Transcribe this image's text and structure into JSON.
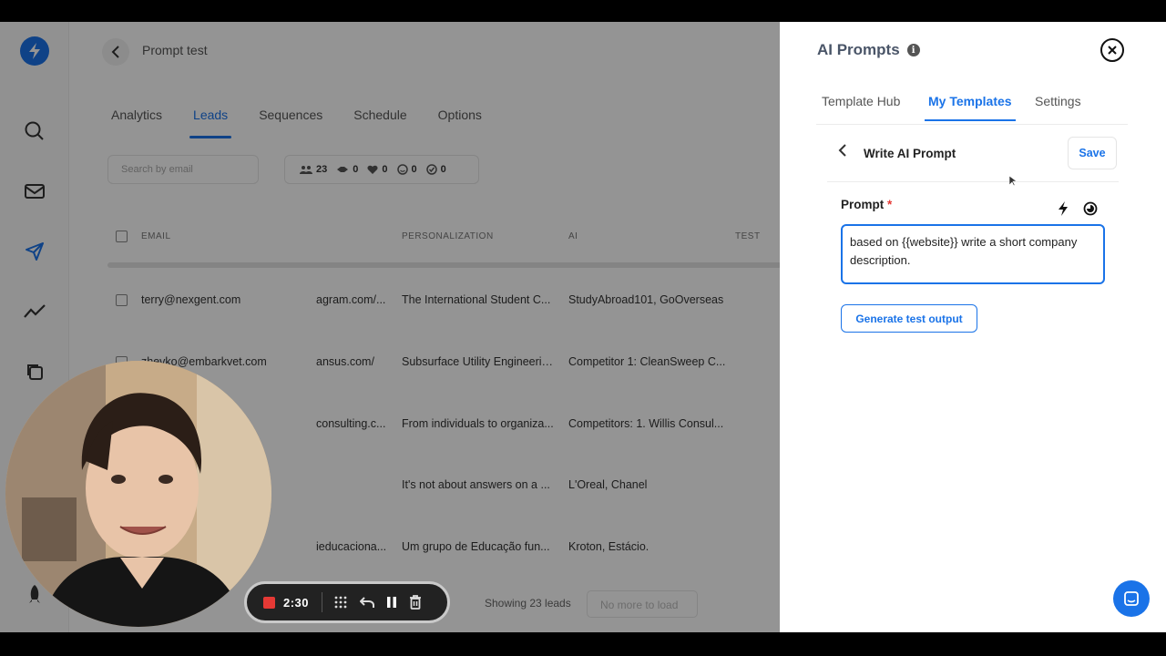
{
  "app": {
    "page_title": "Prompt test",
    "tabs": [
      {
        "label": "Analytics",
        "active": false
      },
      {
        "label": "Leads",
        "active": true
      },
      {
        "label": "Sequences",
        "active": false
      },
      {
        "label": "Schedule",
        "active": false
      },
      {
        "label": "Options",
        "active": false
      }
    ],
    "search_placeholder": "Search by email",
    "stats": {
      "leads": "23",
      "contacted": "0",
      "opened": "0",
      "replied": "0",
      "completed": "0"
    },
    "columns": {
      "email": "EMAIL",
      "personalization": "PERSONALIZATION",
      "ai": "AI",
      "test": "TEST"
    },
    "rows": [
      {
        "email": "terry@nexgent.com",
        "website": "agram.com/...",
        "personalization": "The International Student C...",
        "ai": "StudyAbroad101, GoOverseas"
      },
      {
        "email": "zhevko@embarkvet.com",
        "website": "ansus.com/",
        "personalization": "Subsurface Utility Engineerin...",
        "ai": "Competitor 1: CleanSweep C..."
      },
      {
        "email": "",
        "website": "consulting.c...",
        "personalization": "From individuals to organiza...",
        "ai": "Competitors: 1. Willis Consul..."
      },
      {
        "email": "",
        "website": "",
        "personalization": "It's not about answers on a ...",
        "ai": "L'Oreal, Chanel"
      },
      {
        "email": "",
        "website": "ieducaciona...",
        "personalization": "Um grupo de Educação fun...",
        "ai": "Kroton, Estácio."
      }
    ],
    "showing_text": "Showing 23 leads",
    "no_more_label": "No more to load"
  },
  "panel": {
    "title": "AI Prompts",
    "tabs": [
      {
        "label": "Template Hub",
        "active": false
      },
      {
        "label": "My Templates",
        "active": true
      },
      {
        "label": "Settings",
        "active": false
      }
    ],
    "sub_title": "Write AI Prompt",
    "save_label": "Save",
    "prompt_label": "Prompt",
    "required_mark": "*",
    "prompt_text": "based on {{website}} write a short company description.",
    "generate_label": "Generate test output"
  },
  "recorder": {
    "time": "2:30"
  },
  "colors": {
    "accent": "#1a73e8",
    "required": "#e53935",
    "record": "#e53935"
  }
}
